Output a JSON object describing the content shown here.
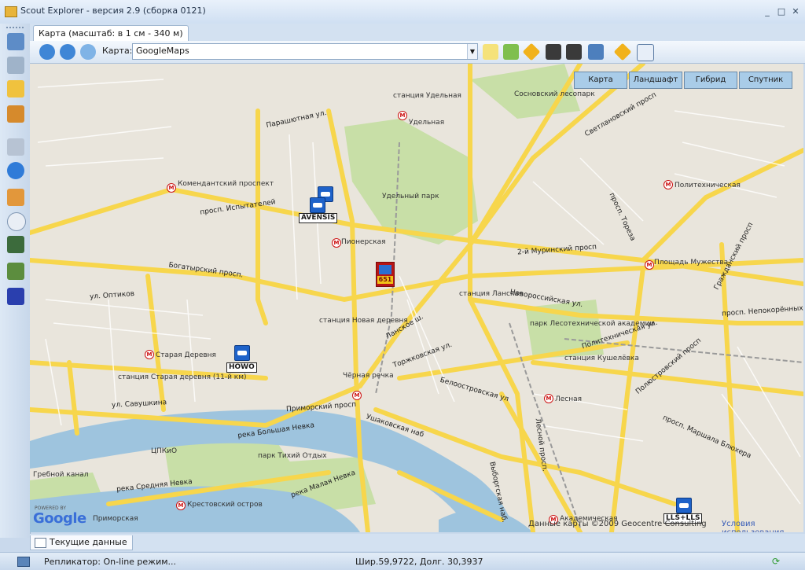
{
  "window": {
    "title": "Scout Explorer - версия 2.9 (сборка 0121)",
    "minimize": "_",
    "maximize": "□",
    "close": "✕"
  },
  "tab": {
    "label": "Карта (масштаб: в 1 см - 340 м)"
  },
  "toolbar": {
    "map_label": "Карта:",
    "map_selected": "GoogleMaps",
    "icons": [
      "zoom-in-icon",
      "zoom-out-icon",
      "zoom-search-icon",
      "note-icon",
      "area-icon",
      "route-sign-icon",
      "binoculars-s-icon",
      "binoculars-t-icon",
      "screen-icon",
      "road-sign-icon",
      "clock-icon"
    ]
  },
  "map_type_buttons": [
    "Карта",
    "Ландшафт",
    "Гибрид",
    "Спутник"
  ],
  "map_labels": {
    "station_udelnaya": "станция Удельная",
    "metro_udelnaya": "Удельная",
    "sosnovsky": "Сосновский лесопарк",
    "udelny_park": "Удельный парк",
    "komend": "Комендантский проспект",
    "pionerskaya": "Пионерская",
    "politech": "Политехническая",
    "muzhestva": "Площадь Мужества",
    "lanskaya": "станция Ланская",
    "lesotech": "парк Лесотехнической академии",
    "kushelevka": "станция Кушелёвка",
    "novaya_derevnya": "станция Новая деревня",
    "staraya_derevnya": "Старая Деревня",
    "staraya_derevnya_st": "станция Старая деревня (11-й км)",
    "chernaya_rechka": "Чёрная речка",
    "lesnaya": "Лесная",
    "tsvkio": "ЦПКиО",
    "grebnoy": "Гребной канал",
    "park_tikhiy": "парк Тихий Отдых",
    "krestovsky": "Крестовский остров",
    "primorskaya": "Приморская",
    "akademicheskaya": "Академическая",
    "parashyutnaya": "Парашютная ул.",
    "pr_ispytateley": "просп. Испытателей",
    "bogatyrsky": "Богатырский просп.",
    "ul_optikov": "ул. Оптиков",
    "ul_savushkina": "ул. Савушкина",
    "primorsky": "Приморский просп",
    "bolshaya_nevka": "река Большая Невка",
    "srednyaya_nevka": "река Средняя Невка",
    "malaya_nevka": "река Малая Невка",
    "novorossiyskaya": "Новороссийская ул.",
    "politekhnicheskaya_ul": "Политехническая ул.",
    "svetlanovsky": "Светлановский просп",
    "toreza": "просп. Тореза",
    "murinsky": "2-й Муринский просп",
    "lanskoe": "Ланское ш.",
    "torzhkovskaya": "Торжковская ул.",
    "beloostrovskaya": "Белоостровская ул",
    "ushakovskaya": "Ушаковская наб",
    "nepokorennykh": "просп. Непокорённых",
    "polyustrovsky": "Полюстровский просп",
    "maршala_blyukhera": "просп. Маршала Блюхера",
    "vyborgskaya": "Выборгская наб.",
    "lesnoy_pr": "Лесной просп.",
    "grazhdansky": "Гражданский просп"
  },
  "vehicles": [
    {
      "label": "AVENSIS"
    },
    {
      "label": "HOWO"
    },
    {
      "label": "651"
    },
    {
      "label": "LLS+LLS"
    }
  ],
  "map_footer": {
    "google_logo": "Google",
    "powered_by": "POWERED BY",
    "copyright": "Данные карты ©2009 Geocentre Consulting",
    "terms": "Условия использования"
  },
  "bottom_tab": {
    "label": "Текущие данные"
  },
  "statusbar": {
    "replicator": "Репликатор: On-line режим...",
    "coords": "Шир.59,9722, Долг. 30,3937"
  }
}
